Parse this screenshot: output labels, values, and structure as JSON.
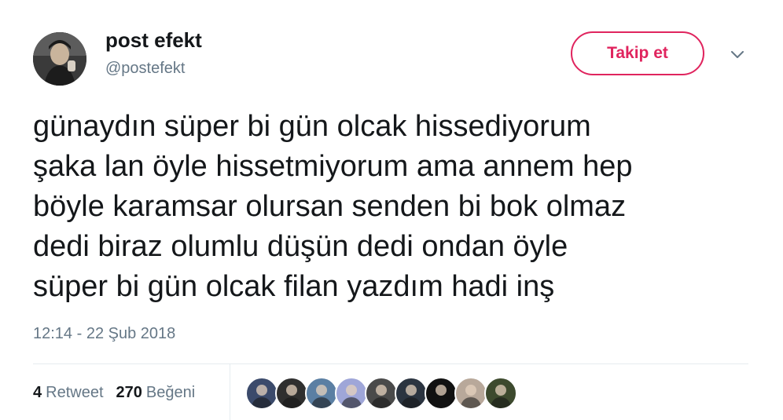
{
  "user": {
    "display_name": "post efekt",
    "handle": "@postefekt",
    "avatar_icon": "user-avatar"
  },
  "follow_button": {
    "label": "Takip et",
    "color": "#e0245e"
  },
  "menu": {
    "icon": "chevron-down-icon"
  },
  "tweet": {
    "text": "günaydın süper bi gün olcak hissediyorum\nşaka lan öyle hissetmiyorum ama annem hep\nböyle karamsar olursan senden bi bok olmaz\ndedi biraz olumlu düşün dedi ondan öyle\nsüper bi gün olcak filan yazdım hadi inş",
    "timestamp": "12:14 - 22 Şub 2018"
  },
  "stats": {
    "retweets": {
      "count": "4",
      "label": "Retweet"
    },
    "likes": {
      "count": "270",
      "label": "Beğeni"
    }
  },
  "likers": [
    {
      "icon": "liker-avatar",
      "color": "#3b4a6b"
    },
    {
      "icon": "liker-avatar",
      "color": "#2f2f2f"
    },
    {
      "icon": "liker-avatar",
      "color": "#5b7fa3"
    },
    {
      "icon": "liker-avatar",
      "color": "#9fa6d8"
    },
    {
      "icon": "liker-avatar",
      "color": "#4a4a4a"
    },
    {
      "icon": "liker-avatar",
      "color": "#2b3440"
    },
    {
      "icon": "liker-avatar",
      "color": "#111111"
    },
    {
      "icon": "liker-avatar",
      "color": "#b8a89a"
    },
    {
      "icon": "liker-avatar",
      "color": "#3d4a2e"
    }
  ]
}
